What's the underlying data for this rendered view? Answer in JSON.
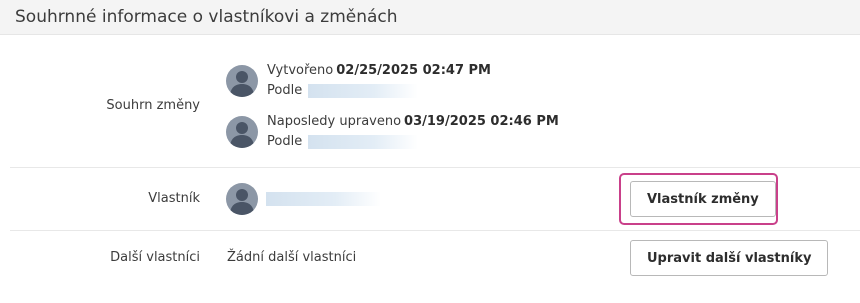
{
  "header": {
    "title": "Souhrnné informace o vlastníkovi a změnách"
  },
  "summary": {
    "label": "Souhrn změny",
    "created": {
      "prefix": "Vytvořeno",
      "datetime": "02/25/2025 02:47 PM",
      "by_label": "Podle"
    },
    "modified": {
      "prefix": "Naposledy upraveno",
      "datetime": "03/19/2025 02:46 PM",
      "by_label": "Podle"
    }
  },
  "owner": {
    "label": "Vlastník",
    "change_button": "Vlastník změny"
  },
  "other_owners": {
    "label": "Další vlastníci",
    "value": "Žádní další vlastníci",
    "edit_button": "Upravit další vlastníky"
  },
  "colors": {
    "focus_ring": "#c9408a",
    "avatar": "#8c97a6",
    "header_bg": "#f4f4f4"
  },
  "icons": [
    "user-avatar-icon"
  ]
}
